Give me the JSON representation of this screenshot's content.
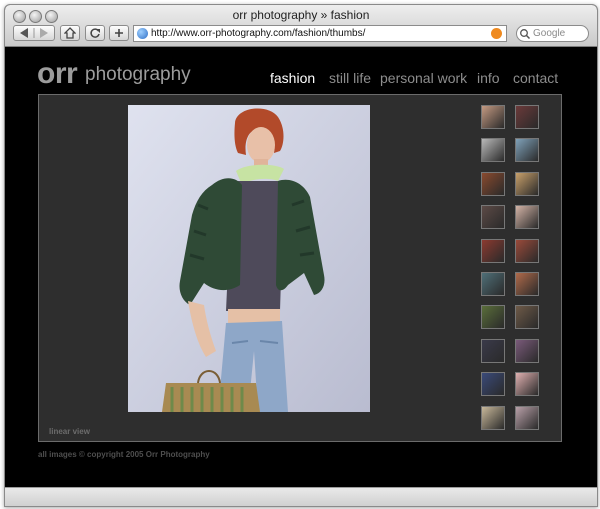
{
  "window": {
    "title": "orr photography » fashion"
  },
  "toolbar": {
    "url": "http://www.orr-photography.com/fashion/thumbs/",
    "search_placeholder": "Google"
  },
  "site": {
    "logo_main": "orr",
    "logo_sub": "photography",
    "nav": [
      {
        "label": "fashion",
        "active": true
      },
      {
        "label": "still life",
        "active": false
      },
      {
        "label": "personal work",
        "active": false
      },
      {
        "label": "info",
        "active": false
      },
      {
        "label": "contact",
        "active": false
      }
    ],
    "view_link": "linear view",
    "copyright": "all images © copyright 2005 Orr Photography"
  },
  "thumbnails": [
    "#c49a82",
    "#6b3a3a",
    "#b9b9b9",
    "#7fa1b9",
    "#8a4a2e",
    "#c8a06a",
    "#5c4a46",
    "#d3b3a6",
    "#8c3a30",
    "#9a4a3a",
    "#4f6f78",
    "#b06a4a",
    "#5a6e3a",
    "#6e5a48",
    "#3a3a4a",
    "#7a5a7a",
    "#3a4a7a",
    "#e0b0b0",
    "#c8b89a",
    "#b8a0a8"
  ]
}
